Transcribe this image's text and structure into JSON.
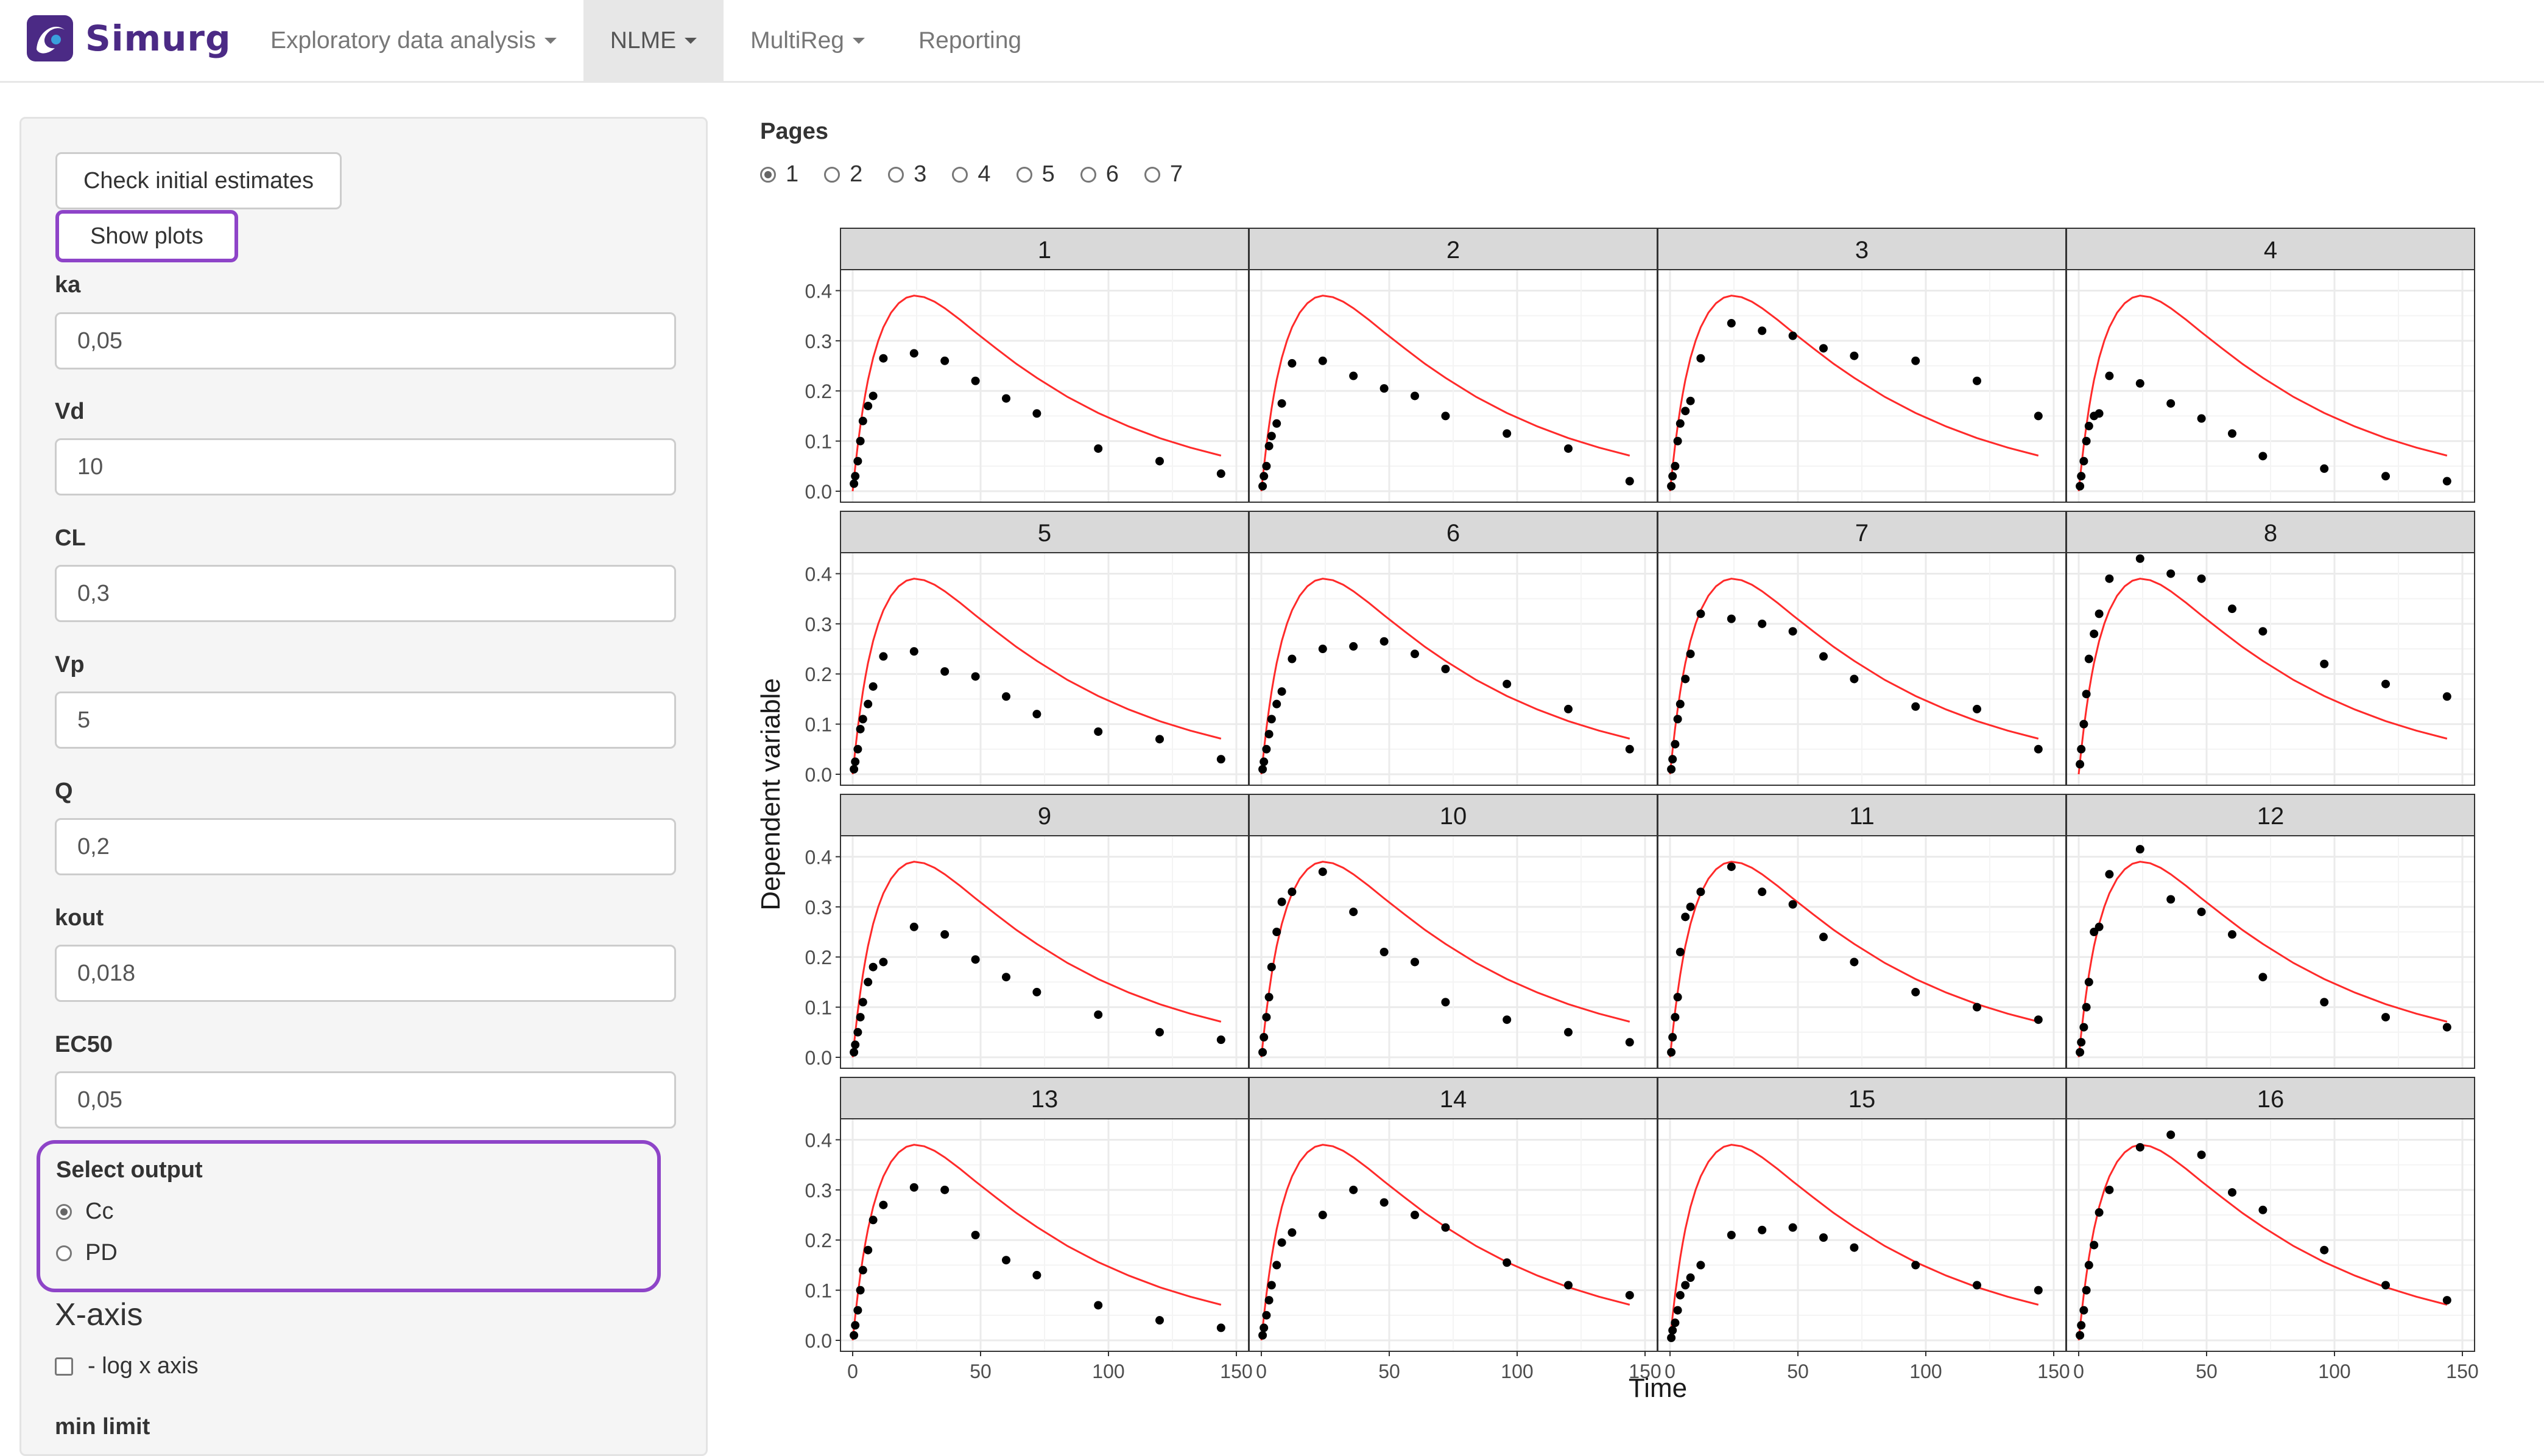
{
  "app": {
    "brand": "Simurg",
    "brand_color": "#4b2a85",
    "accent": "#8e44c8"
  },
  "nav": [
    {
      "label": "Exploratory data analysis",
      "dropdown": true,
      "active": false
    },
    {
      "label": "NLME",
      "dropdown": true,
      "active": true
    },
    {
      "label": "MultiReg",
      "dropdown": true,
      "active": false
    },
    {
      "label": "Reporting",
      "dropdown": false,
      "active": false
    }
  ],
  "sidebar": {
    "check_button": "Check initial estimates",
    "show_plots_button": "Show plots",
    "params": [
      {
        "label": "ka",
        "value": "0,05"
      },
      {
        "label": "Vd",
        "value": "10"
      },
      {
        "label": "CL",
        "value": "0,3"
      },
      {
        "label": "Vp",
        "value": "5"
      },
      {
        "label": "Q",
        "value": "0,2"
      },
      {
        "label": "kout",
        "value": "0,018"
      },
      {
        "label": "EC50",
        "value": "0,05"
      }
    ],
    "select_output": {
      "label": "Select output",
      "options": [
        "Cc",
        "PD"
      ],
      "selected": "Cc"
    },
    "xaxis_title": "X-axis",
    "log_x_label": "- log x axis",
    "log_x_checked": false,
    "min_limit_label": "min limit"
  },
  "pages": {
    "label": "Pages",
    "options": [
      "1",
      "2",
      "3",
      "4",
      "5",
      "6",
      "7"
    ],
    "selected": "1"
  },
  "chart_data": {
    "type": "scatter",
    "layout": "facet 4x4",
    "xlabel": "Time",
    "ylabel": "Dependent variable",
    "xlim": [
      0,
      150
    ],
    "ylim": [
      0,
      0.42
    ],
    "xticks": [
      0,
      50,
      100,
      150
    ],
    "yticks": [
      0.0,
      0.1,
      0.2,
      0.3,
      0.4
    ],
    "ytick_labels": [
      "0.0",
      "0.1",
      "0.2",
      "0.3",
      "0.4"
    ],
    "grid": true,
    "line_color": "#ff2a2a",
    "point_color": "#000000",
    "x": [
      0.5,
      1,
      2,
      3,
      4,
      6,
      8,
      12,
      24,
      36,
      48,
      60,
      72,
      96,
      120,
      144
    ],
    "model_curve": {
      "x": [
        0,
        1,
        2,
        3,
        4,
        5,
        6,
        8,
        10,
        12,
        15,
        18,
        21,
        24,
        28,
        32,
        36,
        42,
        48,
        56,
        64,
        72,
        84,
        96,
        108,
        120,
        132,
        144
      ],
      "y": [
        0,
        0.048,
        0.092,
        0.13,
        0.165,
        0.195,
        0.222,
        0.266,
        0.3,
        0.327,
        0.356,
        0.375,
        0.386,
        0.39,
        0.387,
        0.378,
        0.365,
        0.342,
        0.317,
        0.285,
        0.254,
        0.226,
        0.188,
        0.156,
        0.129,
        0.106,
        0.087,
        0.071
      ]
    },
    "panels": [
      {
        "id": "1",
        "y": [
          0.015,
          0.03,
          0.06,
          0.1,
          0.14,
          0.17,
          0.19,
          0.265,
          0.275,
          0.26,
          0.22,
          0.185,
          0.155,
          0.085,
          0.06,
          0.035
        ]
      },
      {
        "id": "2",
        "y": [
          0.01,
          0.03,
          0.05,
          0.09,
          0.11,
          0.135,
          0.175,
          0.255,
          0.26,
          0.23,
          0.205,
          0.19,
          0.15,
          0.115,
          0.085,
          0.02
        ]
      },
      {
        "id": "3",
        "y": [
          0.01,
          0.03,
          0.05,
          0.1,
          0.135,
          0.16,
          0.18,
          0.265,
          0.335,
          0.32,
          0.31,
          0.285,
          0.27,
          0.26,
          0.22,
          0.15
        ]
      },
      {
        "id": "4",
        "y": [
          0.01,
          0.03,
          0.06,
          0.1,
          0.13,
          0.15,
          0.155,
          0.23,
          0.215,
          0.175,
          0.145,
          0.115,
          0.07,
          0.045,
          0.03,
          0.02
        ]
      },
      {
        "id": "5",
        "y": [
          0.01,
          0.025,
          0.05,
          0.09,
          0.11,
          0.14,
          0.175,
          0.235,
          0.245,
          0.205,
          0.195,
          0.155,
          0.12,
          0.085,
          0.07,
          0.03
        ]
      },
      {
        "id": "6",
        "y": [
          0.01,
          0.025,
          0.05,
          0.08,
          0.11,
          0.14,
          0.165,
          0.23,
          0.25,
          0.255,
          0.265,
          0.24,
          0.21,
          0.18,
          0.13,
          0.05
        ]
      },
      {
        "id": "7",
        "y": [
          0.01,
          0.03,
          0.06,
          0.11,
          0.14,
          0.19,
          0.24,
          0.32,
          0.31,
          0.3,
          0.285,
          0.235,
          0.19,
          0.135,
          0.13,
          0.05
        ]
      },
      {
        "id": "8",
        "y": [
          0.02,
          0.05,
          0.1,
          0.16,
          0.23,
          0.28,
          0.32,
          0.39,
          0.43,
          0.4,
          0.39,
          0.33,
          0.285,
          0.22,
          0.18,
          0.155
        ]
      },
      {
        "id": "9",
        "y": [
          0.01,
          0.025,
          0.05,
          0.08,
          0.11,
          0.15,
          0.18,
          0.19,
          0.26,
          0.245,
          0.195,
          0.16,
          0.13,
          0.085,
          0.05,
          0.035
        ]
      },
      {
        "id": "10",
        "y": [
          0.01,
          0.04,
          0.08,
          0.12,
          0.18,
          0.25,
          0.31,
          0.33,
          0.37,
          0.29,
          0.21,
          0.19,
          0.11,
          0.075,
          0.05,
          0.03
        ]
      },
      {
        "id": "11",
        "y": [
          0.01,
          0.04,
          0.08,
          0.12,
          0.21,
          0.28,
          0.3,
          0.33,
          0.38,
          0.33,
          0.305,
          0.24,
          0.19,
          0.13,
          0.1,
          0.075
        ]
      },
      {
        "id": "12",
        "y": [
          0.01,
          0.03,
          0.06,
          0.1,
          0.15,
          0.25,
          0.26,
          0.365,
          0.415,
          0.315,
          0.29,
          0.245,
          0.16,
          0.11,
          0.08,
          0.06
        ]
      },
      {
        "id": "13",
        "y": [
          0.01,
          0.03,
          0.06,
          0.1,
          0.14,
          0.18,
          0.24,
          0.27,
          0.305,
          0.3,
          0.21,
          0.16,
          0.13,
          0.07,
          0.04,
          0.025
        ]
      },
      {
        "id": "14",
        "y": [
          0.01,
          0.025,
          0.05,
          0.08,
          0.11,
          0.15,
          0.195,
          0.215,
          0.25,
          0.3,
          0.275,
          0.25,
          0.225,
          0.155,
          0.11,
          0.09
        ]
      },
      {
        "id": "15",
        "y": [
          0.005,
          0.02,
          0.035,
          0.06,
          0.09,
          0.11,
          0.125,
          0.15,
          0.21,
          0.22,
          0.225,
          0.205,
          0.185,
          0.15,
          0.11,
          0.1
        ]
      },
      {
        "id": "16",
        "y": [
          0.01,
          0.03,
          0.06,
          0.1,
          0.15,
          0.19,
          0.255,
          0.3,
          0.385,
          0.41,
          0.37,
          0.295,
          0.26,
          0.18,
          0.11,
          0.08
        ]
      }
    ]
  }
}
